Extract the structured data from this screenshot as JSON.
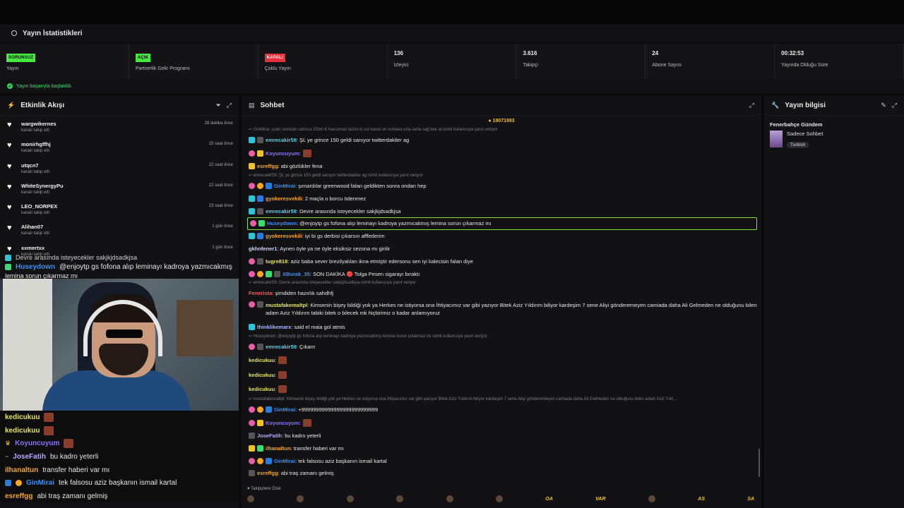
{
  "stats": {
    "title": "Yayın İstatistikleri",
    "items": [
      {
        "badge": "SORUNSUZ",
        "badge_color": "green",
        "label": "Yayın"
      },
      {
        "badge": "AÇIK",
        "badge_color": "green",
        "label": "Partnerlik Gelir Programı"
      },
      {
        "badge": "KAPALI",
        "badge_color": "red",
        "label": "Çoklu Yayın"
      },
      {
        "value": "136",
        "label": "İzleyici"
      },
      {
        "value": "3.616",
        "label": "Takipçi"
      },
      {
        "value": "24",
        "label": "Abone Sayısı"
      },
      {
        "value": "00:32:53",
        "label": "Yayında Olduğu Süre"
      }
    ],
    "status": "Yayın başarıyla başlatıldı."
  },
  "activity": {
    "title": "Etkinlik Akışı",
    "items": [
      {
        "name": "wargwikernes",
        "sub": "kanalı takip etti",
        "time": "28 dakika önce"
      },
      {
        "name": "monirhgffhj",
        "sub": "kanalı takip etti",
        "time": "15 saat önce"
      },
      {
        "name": "utqcn7",
        "sub": "kanalı takip etti",
        "time": "22 saat önce"
      },
      {
        "name": "WhiteSynergyPu",
        "sub": "kanalı takip etti",
        "time": "22 saat önce"
      },
      {
        "name": "LEO_NORPEX",
        "sub": "kanalı takip etti",
        "time": "23 saat önce"
      },
      {
        "name": "Alihan07",
        "sub": "kanalı takip etti",
        "time": "1 gün önce"
      },
      {
        "name": "xxmertxx",
        "sub": "kanalı takip etti",
        "time": "1 gün önce"
      }
    ]
  },
  "overlay": {
    "top_line1": "Devre arasında isteyecekler sakjkjdsadkjsa",
    "top_user": "Huseydown",
    "top_text": "@enjoytp gs fofona alıp leminayı kadroya yazmıcakmış",
    "top_text2": "lemina sorun çıkarmaz mı",
    "lines": [
      {
        "user": "kedicukuu",
        "color": "#e6e35a",
        "text": ""
      },
      {
        "user": "kedicukuu",
        "color": "#e6e35a",
        "text": ""
      },
      {
        "user": "Koyuncuyum",
        "color": "#8a73ff",
        "text": ""
      },
      {
        "user": "JoseFatih",
        "color": "#c0a5ff",
        "text": "bu kadro yeterli"
      },
      {
        "user": "ilhanaltun",
        "color": "#f5a623",
        "text": "transfer haberi var mı"
      },
      {
        "user": "GinMirai",
        "color": "#3d8ef0",
        "text": "tek falsosu aziz başkanın ismail kartal"
      },
      {
        "user": "esreffgg",
        "color": "#f5a623",
        "text": "abi traş zamanı gelmiş"
      }
    ]
  },
  "chat": {
    "title": "Sohbet",
    "bits": "19071993",
    "messages": [
      {
        "type": "reply",
        "text": "GinMirai: şuan semedo satınca 150m € harcaman lazım ki sol kanat on numara orta saha sağ bek al isimli kullanıcıya yanıt veriyor"
      },
      {
        "badges": [
          "cyan",
          "gray"
        ],
        "user": "emrecakir59",
        "color": "#5ad1e8",
        "text": "ŞL ye grince 150 geldi sanıyor twitterdakiler ag"
      },
      {
        "badges": [
          "pink",
          "yellow"
        ],
        "user": "Koyuncuyum",
        "color": "#8a73ff",
        "text": "",
        "emote": true
      },
      {
        "badges": [
          "yellow"
        ],
        "user": "esreffgg",
        "color": "#f5a623",
        "text": "abi gözlükler fena"
      },
      {
        "type": "reply",
        "text": "emrecakir59: ŞL ye grince 150 geldi sanıyor twitterdakiler ag isimli kullanıcıya yanıt veriyor"
      },
      {
        "badges": [
          "pink",
          "gold",
          "blue"
        ],
        "user": "GinMirai",
        "color": "#3d8ef0",
        "text": "şımardılar greenwood falan geldikten sonra ondan hep"
      },
      {
        "badges": [
          "cyan",
          "blue"
        ],
        "user": "gyokeresvekili",
        "color": "#f5a623",
        "text": "2 maçla o borcu ödenmez"
      },
      {
        "badges": [
          "cyan",
          "gray"
        ],
        "user": "emrecakir59",
        "color": "#5ad1e8",
        "text": "Devre arasında isteyecekler sakjkjdsadkjsa"
      },
      {
        "badges": [
          "pink",
          "green"
        ],
        "user": "Huseydown",
        "color": "#3d8ef0",
        "text": "@enjoytp gs fofona alıp leminayı kadroya yazmıcakmış lemina sorun çıkarmaz mı",
        "highlight": true
      },
      {
        "badges": [
          "cyan",
          "blue"
        ],
        "user": "gyokeresvekili",
        "color": "#f5a623",
        "text": "iyi bi gs derbisi çıkarsın afffederim"
      },
      {
        "badges": [],
        "user": "gkhnfener1",
        "color": "#cfd6ff",
        "text": "Aynen öyle ya ne öyle eksiksiz sezona mı girilir"
      },
      {
        "badges": [
          "pink",
          "gray"
        ],
        "user": "tugre818",
        "color": "#e6e35a",
        "text": "aziz baba sever brezilyalıları ikna etmiştir edersonu sen iyi kalecisin falan diye"
      },
      {
        "badges": [
          "pink",
          "gold",
          "green",
          "gray"
        ],
        "user": "XBurak_35",
        "color": "#3d8ef0",
        "text": "SON DAKİKA 🔴 Tolga Pesen sigarayı bıraktı"
      },
      {
        "type": "reply",
        "text": "emrecakir59: Devre arasında isteyecekler sakjkjdsadkjsa isimli kullanıcıya yanıt veriyor"
      },
      {
        "badges": [],
        "user": "Fenerista",
        "color": "#ff5a5a",
        "text": "şimdiden hazırlık sahdhfj"
      },
      {
        "badges": [
          "pink",
          "gray"
        ],
        "user": "mustafakemaltpl",
        "color": "#e6e35a",
        "text": "Kimsenin bişey bildiği yok ya Herkes ne istiyorsa ona İhtiyacımız var gibi yazıyor Bitek Aziz Yıldırım biliyor kardeşim 7 sene Aliyi gönderemeyen camiada daha Ali Gelmeden ne olduğunu bilen adam Aziz Yıldırım tabiki bitek o bilecek mk hiçbirimiz o kadar anlamıyoruz",
        "multiline": true
      },
      {
        "badges": [
          "cyan"
        ],
        "user": "thinklikemarx",
        "color": "#a6b8ff",
        "text": "said el maia gol atmis"
      },
      {
        "type": "reply",
        "text": "Huseydown: @enjoytp gs fofona alıp leminayı kadroya yazmıcakmış lemina sorun çıkarmaz mı isimli kullanıcıya yanıt veriyor"
      },
      {
        "badges": [
          "pink",
          "gray"
        ],
        "user": "emrecakir59",
        "color": "#5ad1e8",
        "text": "Çıkarır"
      },
      {
        "badges": [],
        "user": "kedicukuu",
        "color": "#e6e35a",
        "text": "",
        "emote": true,
        "tall": true
      },
      {
        "badges": [],
        "user": "kedicukuu",
        "color": "#e6e35a",
        "text": "",
        "emote": true,
        "tall": true
      },
      {
        "badges": [],
        "user": "kedicukuu",
        "color": "#e6e35a",
        "text": "",
        "emote": true,
        "tall": true
      },
      {
        "type": "reply",
        "text": "mustafakemaltpl: Kimsenin bişey bildiği yok ya Herkes ne istiyorsa ona İhtiyacımız var gibi yazıyor Bitek Aziz Yıldırım biliyor kardeşim 7 sene Aliyi gönderemeyen camiada daha Ali Gelmeden ne olduğunu bilen adam Aziz Yıld..."
      },
      {
        "badges": [
          "pink",
          "gold",
          "blue"
        ],
        "user": "GinMirai",
        "color": "#3d8ef0",
        "text": "+99999999999999999999999999"
      },
      {
        "badges": [
          "pink",
          "yellow"
        ],
        "user": "Koyuncuyum",
        "color": "#8a73ff",
        "text": "",
        "emote": true
      },
      {
        "badges": [
          "gray"
        ],
        "user": "JoseFatih",
        "color": "#c0a5ff",
        "text": "bu kadro yeterli"
      },
      {
        "badges": [
          "yellow",
          "green"
        ],
        "user": "ilhanaltun",
        "color": "#f5a623",
        "text": "transfer haberi var mı"
      },
      {
        "badges": [
          "pink",
          "gold",
          "blue"
        ],
        "user": "GinMirai",
        "color": "#3d8ef0",
        "text": "tek falsosu aziz başkanın ismail kartal"
      },
      {
        "badges": [
          "gray"
        ],
        "user": "esreffgg",
        "color": "#f5a623",
        "text": "abi traş zamanı gelmiş"
      }
    ],
    "footer": "Takipçilere Özel",
    "emote_bar": [
      "",
      "",
      "",
      "",
      "",
      "",
      "OA",
      "VAR",
      "",
      "AS",
      "SA"
    ]
  },
  "info": {
    "title": "Yayın bilgisi",
    "stream_title": "Fenerbahçe Gündem",
    "category": "Sadece Sohbet",
    "tag": "Turkish"
  }
}
